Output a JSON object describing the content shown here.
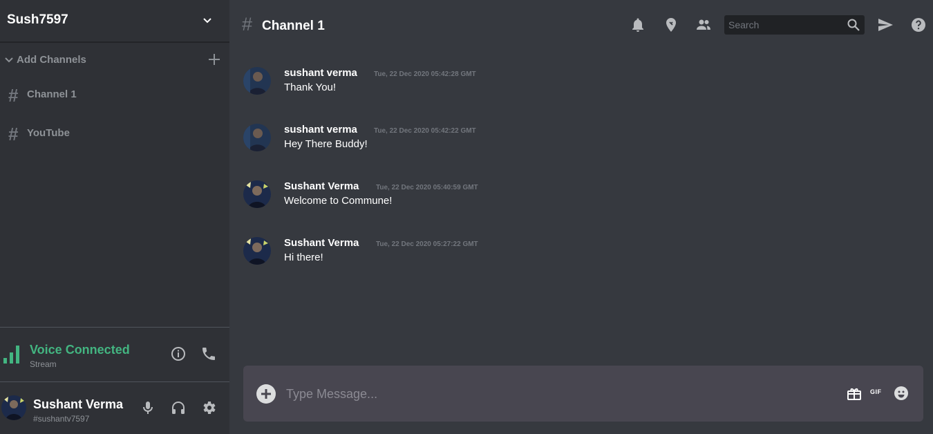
{
  "server": {
    "name": "Sush7597"
  },
  "sidebar": {
    "category_label": "Add Channels",
    "channels": [
      {
        "hash": "#",
        "label": "Channel 1"
      },
      {
        "hash": "#",
        "label": "YouTube"
      }
    ]
  },
  "voice": {
    "title": "Voice Connected",
    "subtitle": "Stream",
    "status_color": "#43b581"
  },
  "user": {
    "name": "Sushant Verma",
    "tag": "#sushantv7597"
  },
  "header": {
    "hash": "#",
    "title": "Channel 1"
  },
  "search": {
    "placeholder": "Search"
  },
  "messages": [
    {
      "author": "sushant verma",
      "time": "Tue, 22 Dec 2020 05:42:28 GMT",
      "text": "Thank You!"
    },
    {
      "author": "sushant verma",
      "time": "Tue, 22 Dec 2020 05:42:22 GMT",
      "text": "Hey There Buddy!"
    },
    {
      "author": "Sushant Verma",
      "time": "Tue, 22 Dec 2020 05:40:59 GMT",
      "text": "Welcome to Commune!"
    },
    {
      "author": "Sushant Verma",
      "time": "Tue, 22 Dec 2020 05:27:22 GMT",
      "text": "Hi there!"
    }
  ],
  "composer": {
    "placeholder": "Type Message...",
    "gif_label": "GIF"
  },
  "icons": {
    "sidebar": [
      "chevron-down-icon",
      "plus-icon",
      "signal-bars-icon",
      "info-icon",
      "phone-icon",
      "microphone-icon",
      "headphones-icon",
      "gear-icon"
    ],
    "header": [
      "bell-icon",
      "pin-icon",
      "members-icon",
      "search-icon",
      "send-icon",
      "help-icon"
    ],
    "composer": [
      "add-circle-icon",
      "gift-icon",
      "gif-icon",
      "emoji-icon"
    ]
  },
  "colors": {
    "sidebar_bg": "#2f3136",
    "main_bg": "#36393f",
    "composer_bg": "#484650",
    "accent_green": "#43b581"
  }
}
